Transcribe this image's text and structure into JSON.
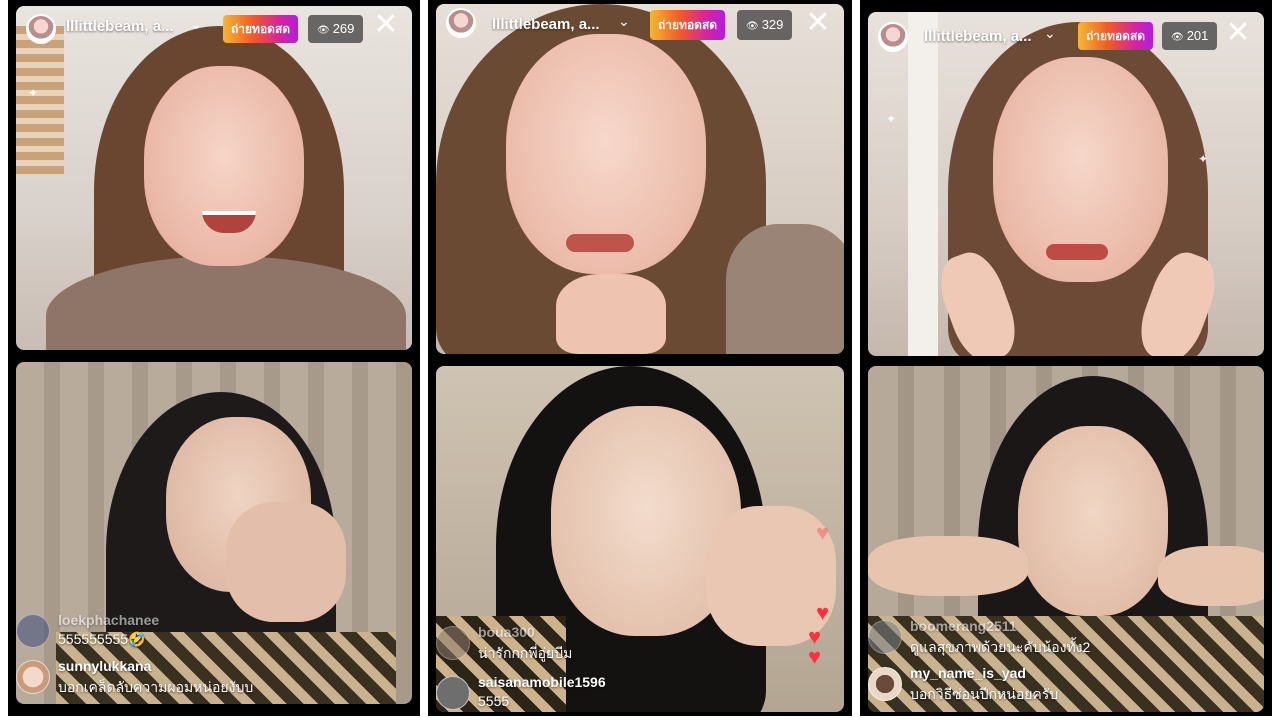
{
  "panels": [
    {
      "host": {
        "username": "lllittlebeam, a...",
        "live_label": "ถ่ายทอดสด",
        "viewer_count": "269"
      },
      "comments": [
        {
          "user": "loekphachanee",
          "text": "555555555🤣"
        },
        {
          "user": "sunnylukkana",
          "text": "บอกเคล็ดลับความผอมหน่อยงับบ"
        }
      ]
    },
    {
      "host": {
        "username": "lllittlebeam, a...",
        "live_label": "ถ่ายทอดสด",
        "viewer_count": "329"
      },
      "comments": [
        {
          "user": "boua300",
          "text": "น่ารักกกพี่อู่ยบีม"
        },
        {
          "user": "saisanamobile1596",
          "text": "5555"
        }
      ]
    },
    {
      "host": {
        "username": "lllittlebeam, a...",
        "live_label": "ถ่ายทอดสด",
        "viewer_count": "201"
      },
      "comments": [
        {
          "user": "boomerang2511",
          "text": "ดูแลสุขภาพด้วยนะคับน้องทั้ง2"
        },
        {
          "user": "my_name_is_yad",
          "text": "บอกวิธีซ่อนปีกหน่อยครับ"
        }
      ]
    }
  ],
  "icons": {
    "eye": "eye-icon",
    "chevron": "chevron-down-icon",
    "close": "close-icon",
    "heart": "heart-icon"
  },
  "colors": {
    "panel_bg": "#000000",
    "live_gradient": [
      "#f7b733",
      "#f05a28",
      "#d6249f",
      "#b21de0"
    ],
    "heart": "#ff3040"
  }
}
